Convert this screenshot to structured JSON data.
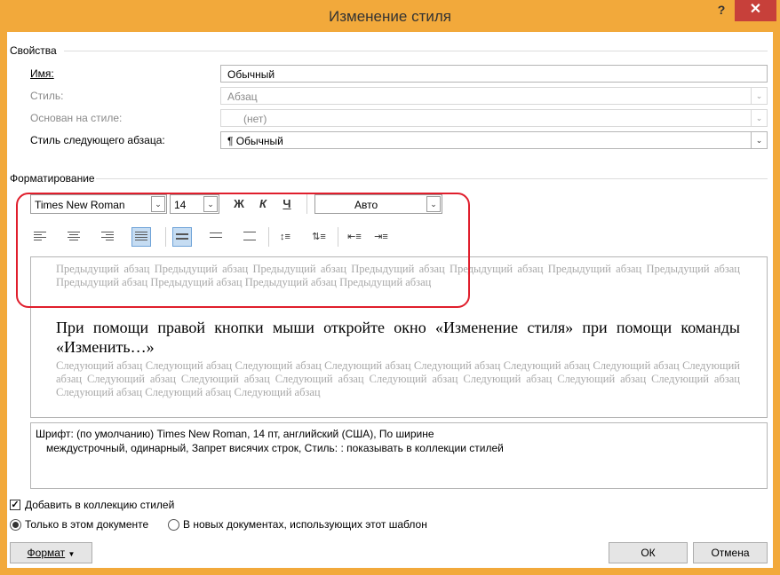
{
  "window": {
    "title": "Изменение стиля",
    "help": "?",
    "close": "✕",
    "frame_color": "#f2a93b",
    "close_color": "#c7403a"
  },
  "properties": {
    "group_label": "Свойства",
    "name_label": "Имя:",
    "name_value": "Обычный",
    "style_label": "Стиль:",
    "style_value": "Абзац",
    "based_on_label": "Основан на стиле:",
    "based_on_value": "(нет)",
    "next_label": "Стиль следующего абзаца:",
    "next_value": "¶ Обычный"
  },
  "formatting": {
    "group_label": "Форматирование",
    "font": "Times New Roman",
    "size": "14",
    "bold": "Ж",
    "italic": "К",
    "underline": "Ч",
    "color": "Авто",
    "active_alignment": "justify"
  },
  "preview": {
    "previous_text": "Предыдущий абзац Предыдущий абзац Предыдущий абзац Предыдущий абзац Предыдущий абзац Предыдущий абзац Предыдущий абзац Предыдущий абзац Предыдущий абзац Предыдущий абзац Предыдущий абзац",
    "main_text": "При помощи правой кнопки мыши откройте окно «Изменение стиля» при помощи команды «Изменить…»",
    "next_text": "Следующий абзац Следующий абзац Следующий абзац Следующий абзац Следующий абзац Следующий абзац Следующий абзац Следующий абзац Следующий абзац Следующий абзац Следующий абзац Следующий абзац Следующий абзац Следующий абзац Следующий абзац Следующий абзац Следующий абзац Следующий абзац"
  },
  "description": {
    "line1": "Шрифт: (по умолчанию) Times New Roman, 14 пт, английский (США), По ширине",
    "line2": "междустрочный,  одинарный, Запрет висячих строк, Стиль: : показывать в коллекции стилей"
  },
  "options": {
    "add_to_gallery": "Добавить в коллекцию стилей",
    "only_this_doc": "Только в этом документе",
    "new_docs": "В новых документах, использующих этот шаблон"
  },
  "buttons": {
    "format": "Формат",
    "ok": "ОК",
    "cancel": "Отмена"
  },
  "annotation_color": "#e01e2c"
}
